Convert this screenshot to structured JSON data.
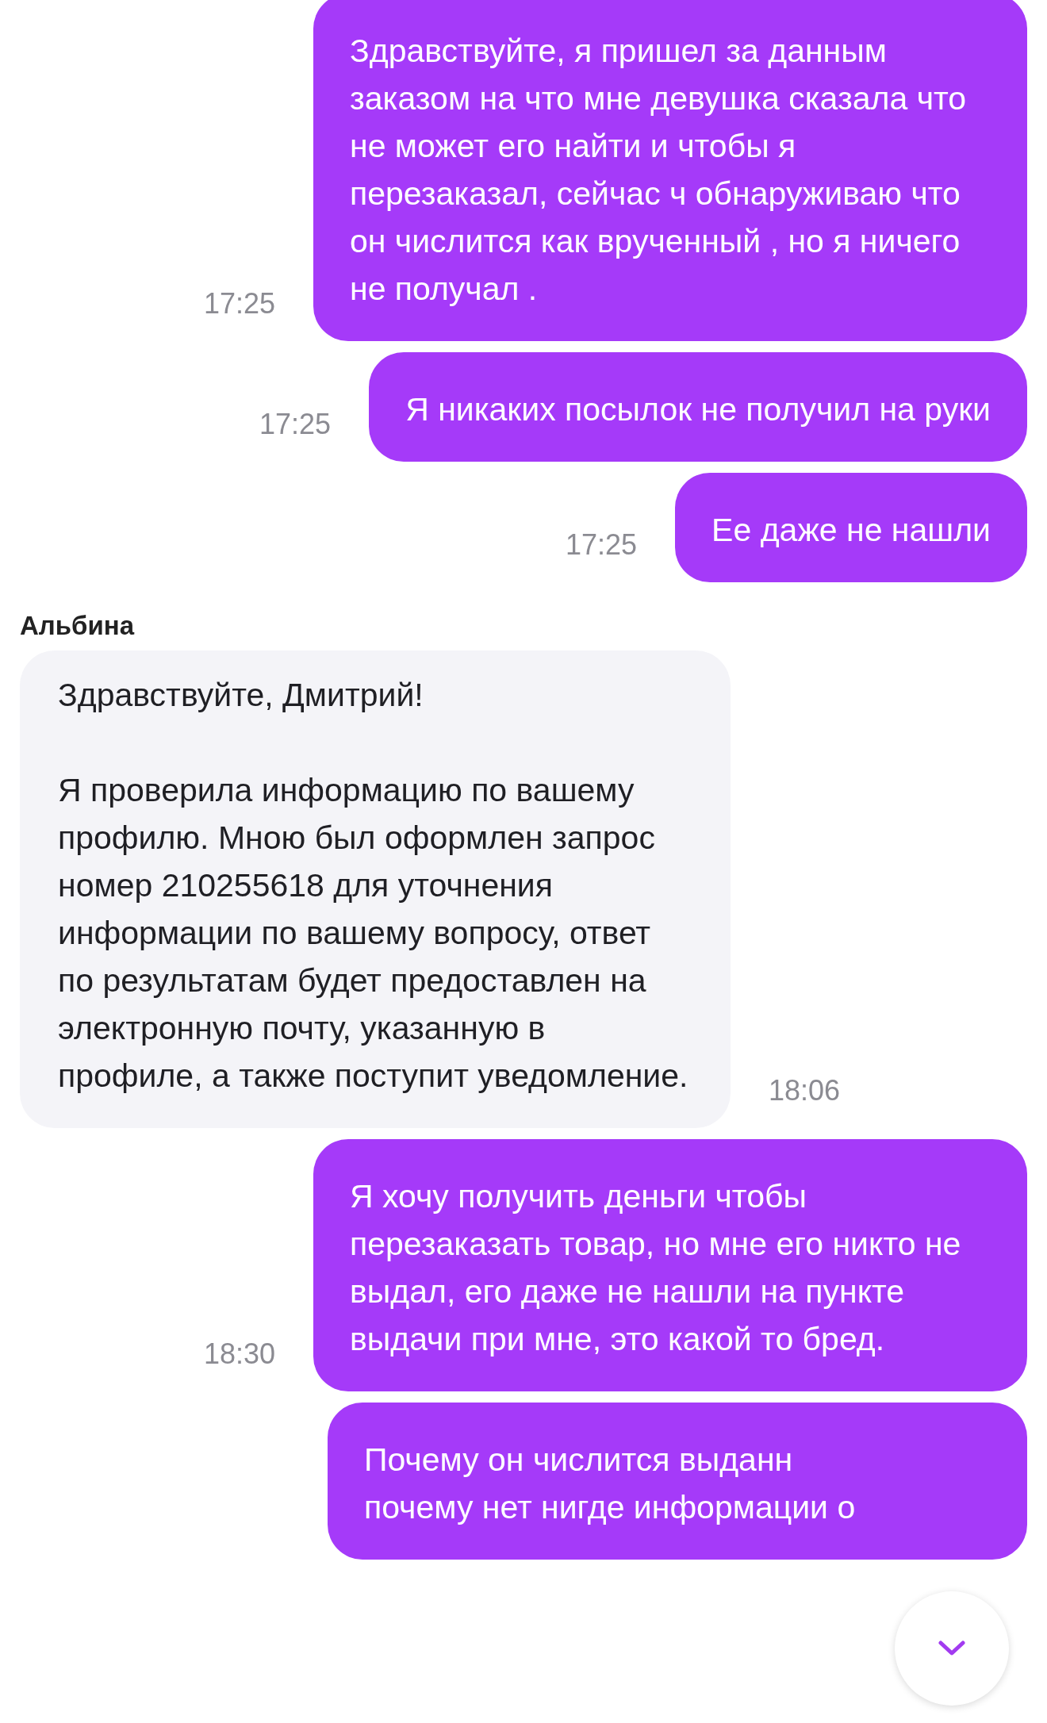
{
  "messages": [
    {
      "kind": "outgoing",
      "text": "Здравствуйте, я пришел за данным заказом на что мне девушка сказала что не может его найти и чтобы я перезаказал, сейчас ч обнаруживаю что он числится как врученный , но я ничего не получал .",
      "time": "17:25"
    },
    {
      "kind": "outgoing",
      "text": "Я никаких посылок не получил на руки",
      "time": "17:25"
    },
    {
      "kind": "outgoing",
      "text": "Ее даже не нашли",
      "time": "17:25"
    },
    {
      "kind": "incoming",
      "sender": "Альбина",
      "text": "Здравствуйте, Дмитрий!\n\nЯ проверила информацию по вашему профилю. Мною был оформлен запрос номер 210255618 для уточнения информации по вашему вопросу, ответ по результатам будет предоставлен на электронную почту, указанную в профиле, а также поступит уведомление.",
      "time": "18:06"
    },
    {
      "kind": "outgoing",
      "text": "Я хочу получить деньги чтобы перезаказать товар, но мне его никто не выдал, его даже не нашли на пункте выдачи при мне, это какой то бред.",
      "time": "18:30"
    },
    {
      "kind": "outgoing",
      "text": "Почему он числится выданн\nпочему нет нигде информации о"
    }
  ]
}
